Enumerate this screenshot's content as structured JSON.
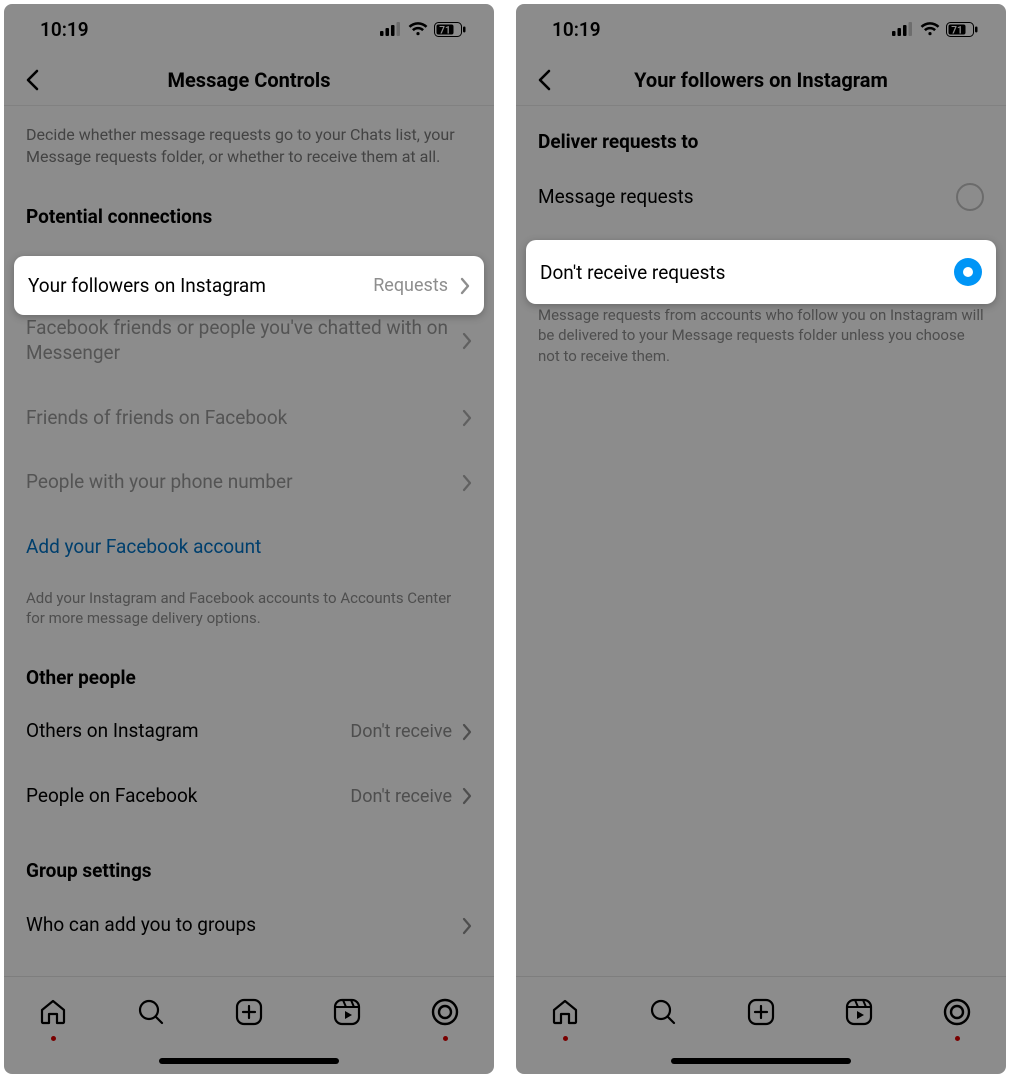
{
  "status": {
    "time": "10:19",
    "battery": "71"
  },
  "left": {
    "header_title": "Message Controls",
    "intro": "Decide whether message requests go to your Chats list, your Message requests folder, or whether to receive them at all.",
    "section_potential": "Potential connections",
    "rows": {
      "followers": {
        "label": "Your followers on Instagram",
        "value": "Requests"
      },
      "fb_friends": {
        "label": "Facebook friends or people you've chatted with on Messenger"
      },
      "fof": {
        "label": "Friends of friends on Facebook"
      },
      "phone": {
        "label": "People with your phone number"
      }
    },
    "add_fb": "Add your Facebook account",
    "add_fb_desc": "Add your Instagram and Facebook accounts to Accounts Center for more message delivery options.",
    "section_other": "Other people",
    "other_rows": {
      "others_ig": {
        "label": "Others on Instagram",
        "value": "Don't receive"
      },
      "people_fb": {
        "label": "People on Facebook",
        "value": "Don't receive"
      }
    },
    "section_group": "Group settings",
    "group_row": "Who can add you to groups"
  },
  "right": {
    "header_title": "Your followers on Instagram",
    "section": "Deliver requests to",
    "opt_requests": "Message requests",
    "opt_dont": "Don't receive requests",
    "footer": "Message requests from accounts who follow you on Instagram will be delivered to your Message requests folder unless you choose not to receive them."
  }
}
